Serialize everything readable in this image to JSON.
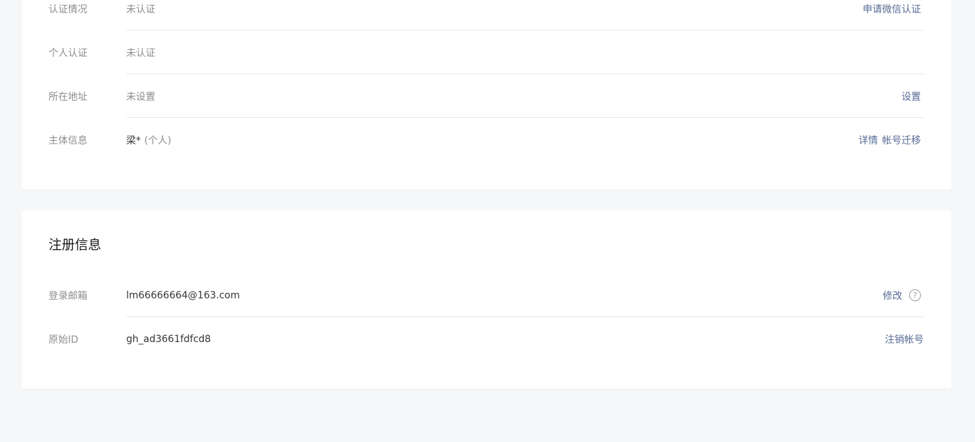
{
  "account_section": {
    "rows": [
      {
        "label": "认证情况",
        "value": "未认证",
        "actions": [
          "申请微信认证"
        ]
      },
      {
        "label": "个人认证",
        "value": "未认证",
        "actions": []
      },
      {
        "label": "所在地址",
        "value": "未设置",
        "actions": [
          "设置"
        ]
      },
      {
        "label": "主体信息",
        "value_name": "梁*",
        "value_type": "(个人)",
        "actions": [
          "详情",
          "帐号迁移"
        ]
      }
    ]
  },
  "registration_section": {
    "title": "注册信息",
    "rows": [
      {
        "label": "登录邮箱",
        "value": "lm66666664@163.com",
        "actions": [
          "修改"
        ],
        "help_icon": "?"
      },
      {
        "label": "原始ID",
        "value": "gh_ad3661fdfcd8",
        "actions": [
          "注销帐号"
        ]
      }
    ]
  },
  "colors": {
    "link": "#576b95",
    "label": "#8d8d8d",
    "text": "#353535",
    "background": "#f6f7f9",
    "divider": "#e7e7eb"
  }
}
